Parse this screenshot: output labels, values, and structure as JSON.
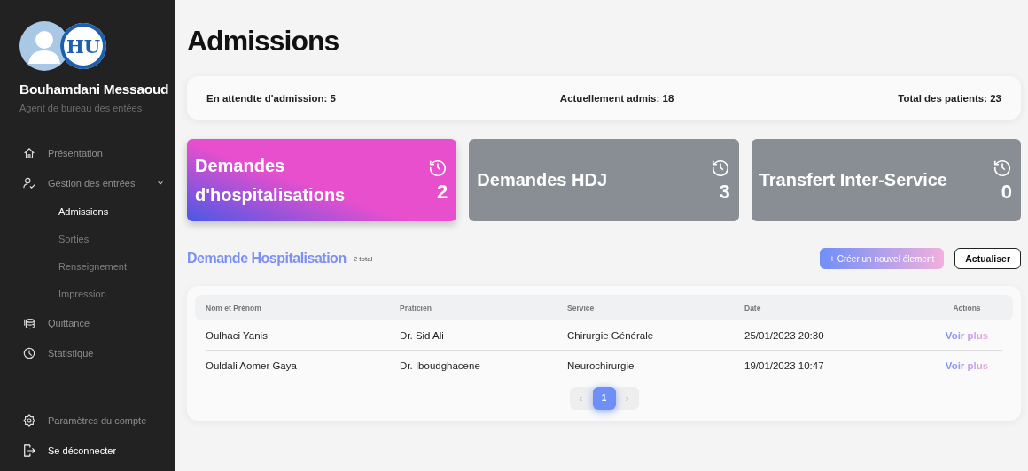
{
  "profile": {
    "name": "Bouhamdani Messaoud",
    "role": "Agent de bureau des entées",
    "logo_text": "HU"
  },
  "nav": [
    {
      "label": "Présentation",
      "kind": "home",
      "selected": false
    },
    {
      "label": "Gestion des entrées",
      "kind": "user",
      "selected": false,
      "expanded": true,
      "children": [
        {
          "label": "Admissions",
          "selected": true
        },
        {
          "label": "Sorties",
          "selected": false
        },
        {
          "label": "Renseignement",
          "selected": false
        },
        {
          "label": "Impression",
          "selected": false
        }
      ]
    },
    {
      "label": "Quittance",
      "kind": "database",
      "selected": false
    },
    {
      "label": "Statistique",
      "kind": "clock",
      "selected": false
    }
  ],
  "bottom_nav": [
    {
      "label": "Paramètres du compte",
      "kind": "settings"
    },
    {
      "label": "Se déconnecter",
      "kind": "logout"
    }
  ],
  "page_title": "Admissions",
  "stats": [
    "En attendte d'admission: 5",
    "Actuellement admis: 18",
    "Total des patients: 23"
  ],
  "cards": [
    {
      "title": "Demandes d'hospitalisations",
      "count": "2",
      "selected": true
    },
    {
      "title": "Demandes HDJ",
      "count": "3",
      "selected": false
    },
    {
      "title": "Transfert Inter-Service",
      "count": "0",
      "selected": false
    }
  ],
  "section": {
    "title": "Demande Hospitalisation",
    "total": "2 total",
    "create_button": "+ Créer un nouvel élement",
    "refresh_button": "Actualiser"
  },
  "table": {
    "columns": [
      "Nom et Prénom",
      "Praticien",
      "Service",
      "Date",
      "Actions"
    ],
    "rows": [
      {
        "cells": [
          "Oulhaci Yanis",
          "Dr. Sid Ali",
          "Chirurgie Générale",
          "25/01/2023 20:30"
        ],
        "action": "Voir plus"
      },
      {
        "cells": [
          "Ouldali Aomer Gaya",
          "Dr. Iboudghacene",
          "Neurochirurgie",
          "19/01/2023 10:47"
        ],
        "action": "Voir plus"
      }
    ]
  },
  "pagination": {
    "prev": "‹",
    "next": "›",
    "pages": [
      {
        "label": "1",
        "selected": true
      }
    ]
  }
}
